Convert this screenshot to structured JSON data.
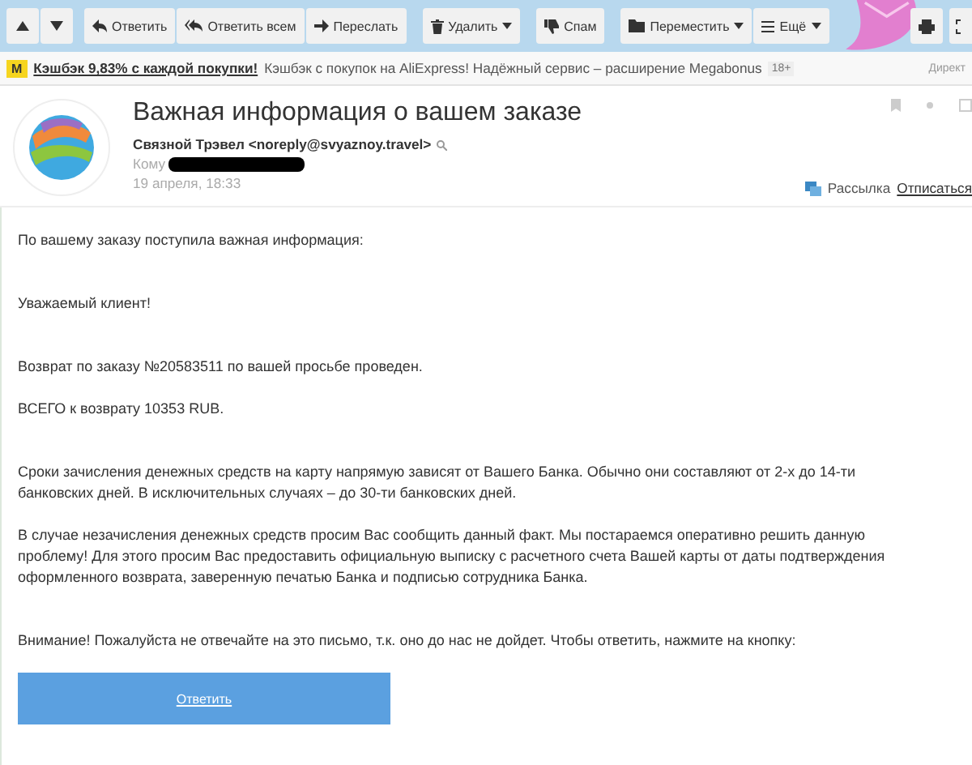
{
  "toolbar": {
    "nav": [
      {
        "kind": "up"
      },
      {
        "kind": "down"
      }
    ],
    "buttons": [
      {
        "label": "Ответить",
        "dropdown": false
      },
      {
        "label": "Ответить всем",
        "dropdown": false
      },
      {
        "label": "Переслать",
        "dropdown": false
      },
      {
        "label": "Удалить",
        "dropdown": true
      },
      {
        "label": "Спам",
        "dropdown": false
      },
      {
        "label": "Переместить",
        "dropdown": true
      },
      {
        "label": "Ещё",
        "dropdown": true
      }
    ]
  },
  "ad": {
    "badge": "M",
    "link": "Кэшбэк 9,83% с каждой покупки!",
    "text": "Кэшбэк с покупок на AliExpress! Надёжный сервис – расширение Megabonus",
    "age": "18+",
    "label": "Директ"
  },
  "message": {
    "subject": "Важная информация о вашем заказе",
    "sender": "Связной Трэвел <noreply@svyaznoy.travel>",
    "to_label": "Кому",
    "recipient_redacted": true,
    "date": "19 апреля, 18:33",
    "mailing": "Рассылка",
    "unsubscribe": "Отписаться"
  },
  "body": [
    {
      "kind": "para",
      "text": "По вашему заказу поступила важная информация:"
    },
    {
      "kind": "para",
      "text": "Уважаемый клиент!"
    },
    {
      "kind": "para",
      "text": "Возврат по заказу №20583511 по вашей просьбе проведен."
    },
    {
      "kind": "para",
      "text": "ВСЕГО к возврату 10353 RUB."
    },
    {
      "kind": "para",
      "text": "Сроки зачисления денежных средств на карту напрямую зависят от Вашего Банка. Обычно они составляют от 2-х до 14-ти банковских дней. В исключительных случаях – до 30-ти банковских дней."
    },
    {
      "kind": "para",
      "text": "В случае незачисления денежных средств просим Вас сообщить данный факт. Мы постараемся оперативно решить данную проблему! Для этого просим Вас предоставить официальную выписку с расчетного счета Вашей карты от даты подтверждения оформленного возврата, заверенную печатью Банка и подписью сотрудника Банка."
    },
    {
      "kind": "para",
      "text": "Внимание! Пожалуйста не отвечайте на это письмо, т.к. оно до нас не дойдет. Чтобы ответить, нажмите на кнопку:"
    },
    {
      "kind": "button",
      "text": "Ответить"
    }
  ]
}
